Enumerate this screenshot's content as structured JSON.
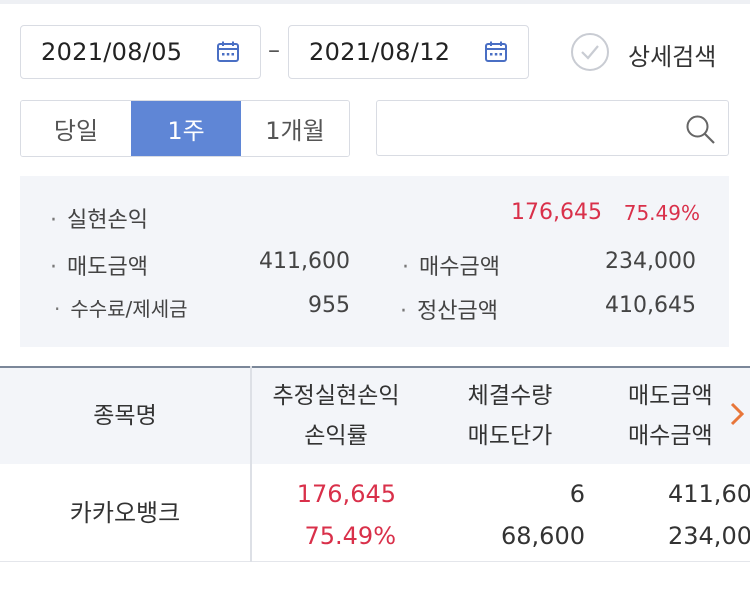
{
  "filters": {
    "start_date": "2021/08/05",
    "date_separator": "–",
    "end_date": "2021/08/12",
    "detail_search_label": "상세검색"
  },
  "period_tabs": [
    {
      "label": "당일",
      "active": false
    },
    {
      "label": "1주",
      "active": true
    },
    {
      "label": "1개월",
      "active": false
    }
  ],
  "search": {
    "value": "",
    "placeholder": ""
  },
  "summary": {
    "realized_pl_label": "실현손익",
    "realized_pl_amount": "176,645",
    "realized_pl_rate": "75.49%",
    "sell_amount_label": "매도금액",
    "sell_amount": "411,600",
    "buy_amount_label": "매수금액",
    "buy_amount": "234,000",
    "fee_tax_label": "수수료/제세금",
    "fee_tax": "955",
    "settlement_label": "정산금액",
    "settlement": "410,645"
  },
  "table": {
    "headers": {
      "name": "종목명",
      "est_pl": "추정실현손익",
      "pl_rate": "손익률",
      "exec_qty": "체결수량",
      "sell_price": "매도단가",
      "sell_amount": "매도금액",
      "buy_amount": "매수금액"
    },
    "rows": [
      {
        "name": "카카오뱅크",
        "est_pl": "176,645",
        "pl_rate": "75.49%",
        "exec_qty": "6",
        "sell_price": "68,600",
        "sell_amount": "411,60",
        "buy_amount": "234,00"
      }
    ]
  },
  "colors": {
    "accent": "#5f86d6",
    "profit": "#d9304a",
    "panel_bg": "#f3f5f9"
  },
  "icons": [
    "calendar-icon",
    "check-circle-icon",
    "search-icon",
    "chevron-right-icon"
  ]
}
